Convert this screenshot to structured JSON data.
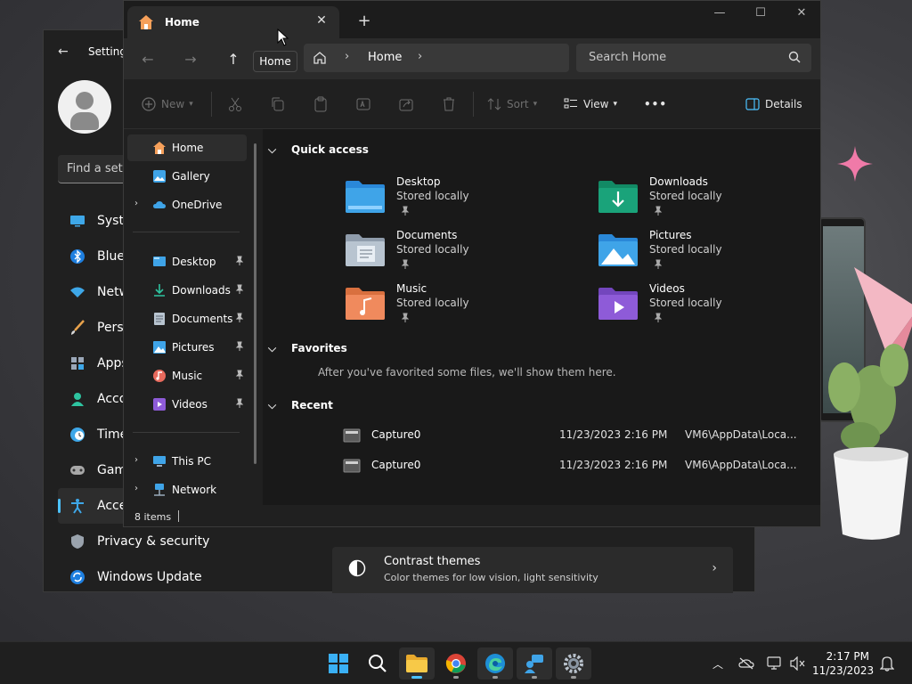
{
  "settings": {
    "title": "Settings",
    "search_placeholder": "Find a setting",
    "nav": [
      {
        "label": "System"
      },
      {
        "label": "Bluetooth & devices"
      },
      {
        "label": "Network & internet"
      },
      {
        "label": "Personalization"
      },
      {
        "label": "Apps"
      },
      {
        "label": "Accounts"
      },
      {
        "label": "Time & language"
      },
      {
        "label": "Gaming"
      },
      {
        "label": "Accessibility"
      },
      {
        "label": "Privacy & security"
      },
      {
        "label": "Windows Update"
      }
    ],
    "contrast_card": {
      "title": "Contrast themes",
      "subtitle": "Color themes for low vision, light sensitivity"
    }
  },
  "explorer": {
    "tab_label": "Home",
    "tooltip": "Home",
    "breadcrumb": "Home",
    "search_placeholder": "Search Home",
    "toolbar": {
      "new_label": "New",
      "sort_label": "Sort",
      "view_label": "View",
      "more_label": "•••",
      "details_label": "Details"
    },
    "sidebar": {
      "top": [
        {
          "label": "Home"
        },
        {
          "label": "Gallery"
        },
        {
          "label": "OneDrive"
        }
      ],
      "pinned": [
        {
          "label": "Desktop"
        },
        {
          "label": "Downloads"
        },
        {
          "label": "Documents"
        },
        {
          "label": "Pictures"
        },
        {
          "label": "Music"
        },
        {
          "label": "Videos"
        }
      ],
      "bottom": [
        {
          "label": "This PC"
        },
        {
          "label": "Network"
        }
      ]
    },
    "sections": {
      "quick_access": "Quick access",
      "favorites": "Favorites",
      "favorites_empty": "After you've favorited some files, we'll show them here.",
      "recent": "Recent"
    },
    "quick_access": [
      {
        "name": "Desktop",
        "sub": "Stored locally"
      },
      {
        "name": "Downloads",
        "sub": "Stored locally"
      },
      {
        "name": "Documents",
        "sub": "Stored locally"
      },
      {
        "name": "Pictures",
        "sub": "Stored locally"
      },
      {
        "name": "Music",
        "sub": "Stored locally"
      },
      {
        "name": "Videos",
        "sub": "Stored locally"
      }
    ],
    "recent": [
      {
        "name": "Capture0",
        "date": "11/23/2023 2:16 PM",
        "location": "VM6\\AppData\\Loca..."
      },
      {
        "name": "Capture0",
        "date": "11/23/2023 2:16 PM",
        "location": "VM6\\AppData\\Loca..."
      }
    ],
    "status": "8 items"
  },
  "taskbar": {
    "time": "2:17 PM",
    "date": "11/23/2023"
  },
  "colors": {
    "accent": "#4cc2ff",
    "folder_blue": "#3fa4e8",
    "downloads_green": "#1aa37a",
    "music_orange": "#f08a5d",
    "videos_purple": "#8e5bd8"
  }
}
